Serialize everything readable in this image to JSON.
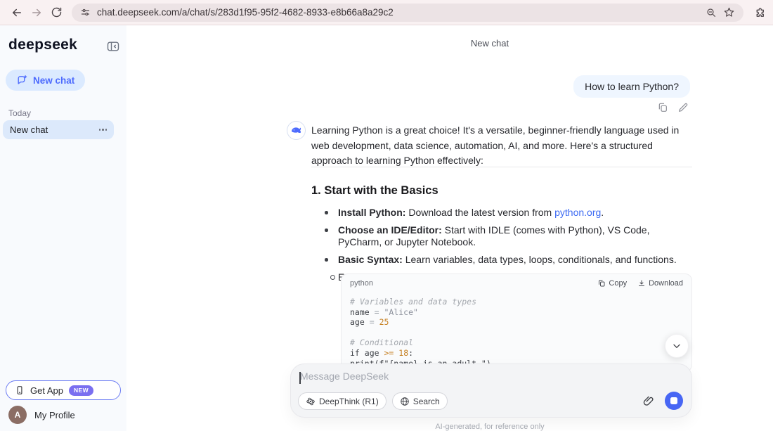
{
  "accent_color": "#4d6bfe",
  "browser": {
    "url": "chat.deepseek.com/a/chat/s/283d1f95-95f2-4682-8933-e8b66a8a29c2"
  },
  "sidebar": {
    "logo": "deepseek",
    "new_chat_label": "New chat",
    "section_today": "Today",
    "history": [
      {
        "label": "New chat"
      }
    ],
    "get_app_label": "Get App",
    "new_badge": "NEW",
    "avatar_initial": "A",
    "profile_label": "My Profile"
  },
  "header": {
    "title": "New chat"
  },
  "chat": {
    "user_message": "How to learn Python?",
    "assistant_intro": "Learning Python is a great choice! It's a versatile, beginner-friendly language used in web development, data science, automation, AI, and more. Here's a structured approach to learning Python effectively:",
    "section_heading": "1. Start with the Basics",
    "bullets": [
      {
        "bold": "Install Python:",
        "pre": " Download the latest version from ",
        "link": "python.org",
        "post": "."
      },
      {
        "bold": "Choose an IDE/Editor:",
        "pre": " Start with IDLE (comes with Python), VS Code, PyCharm, or Jupyter Notebook."
      },
      {
        "bold": "Basic Syntax:",
        "pre": " Learn variables, data types, loops, conditionals, and functions."
      }
    ],
    "sub_bullet": "Example:"
  },
  "code_block": {
    "language": "python",
    "copy_label": "Copy",
    "download_label": "Download",
    "lines": [
      [
        {
          "t": "# Variables and data types",
          "c": "comment"
        }
      ],
      [
        {
          "t": "name",
          "c": "plain"
        },
        {
          "t": " = ",
          "c": "eq"
        },
        {
          "t": "\"Alice\"",
          "c": "str"
        }
      ],
      [
        {
          "t": "age",
          "c": "plain"
        },
        {
          "t": " = ",
          "c": "eq"
        },
        {
          "t": "25",
          "c": "num"
        }
      ],
      [],
      [
        {
          "t": "# Conditional",
          "c": "comment"
        }
      ],
      [
        {
          "t": "if ",
          "c": "plain"
        },
        {
          "t": "age ",
          "c": "plain"
        },
        {
          "t": ">= ",
          "c": "op"
        },
        {
          "t": "18",
          "c": "num"
        },
        {
          "t": ":",
          "c": "plain"
        }
      ],
      [
        {
          "t": "    print(f\"{name} is an adult.\")",
          "c": "plain"
        }
      ]
    ]
  },
  "composer": {
    "placeholder": "Message DeepSeek",
    "deepthink_label": "DeepThink (R1)",
    "search_label": "Search",
    "disclaimer": "AI-generated, for reference only"
  }
}
